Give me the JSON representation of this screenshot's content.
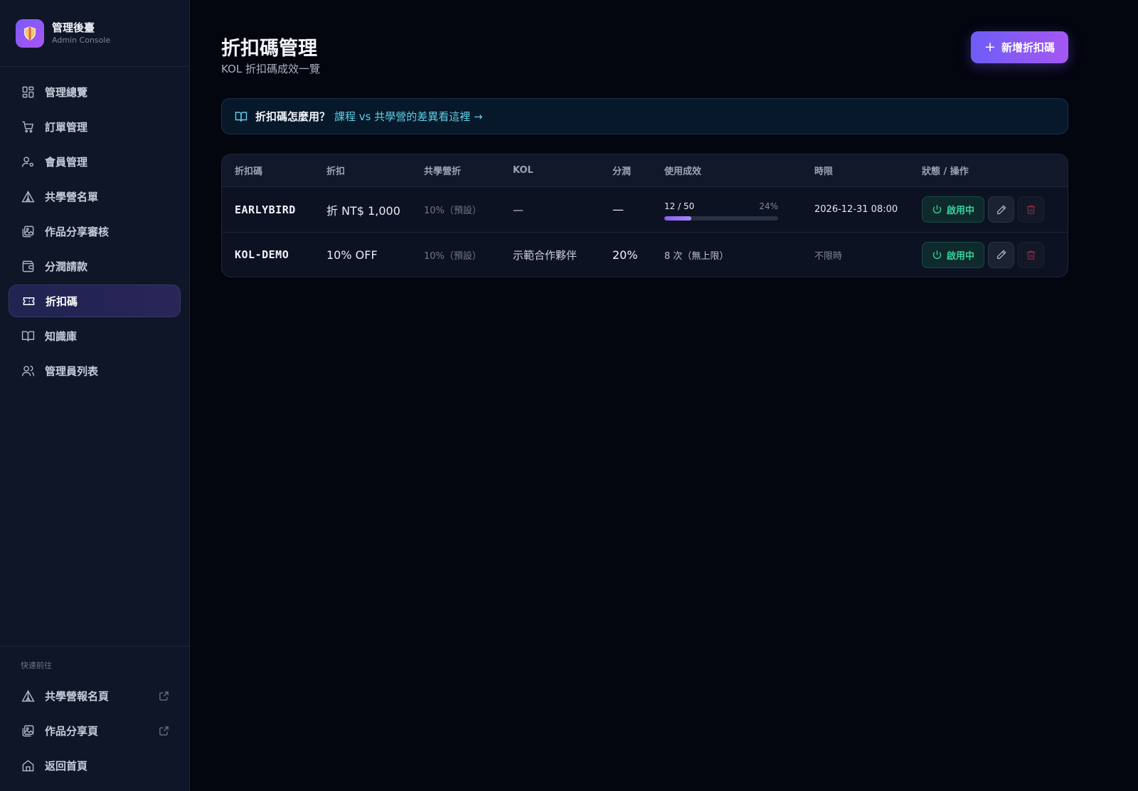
{
  "brand": {
    "title": "管理後臺",
    "subtitle": "Admin Console"
  },
  "nav": {
    "items": [
      {
        "label": "管理總覽",
        "icon": "dashboard-icon"
      },
      {
        "label": "訂單管理",
        "icon": "cart-icon"
      },
      {
        "label": "會員管理",
        "icon": "user-settings-icon"
      },
      {
        "label": "共學營名單",
        "icon": "tent-icon"
      },
      {
        "label": "作品分享審核",
        "icon": "gallery-icon"
      },
      {
        "label": "分潤請款",
        "icon": "wallet-icon"
      },
      {
        "label": "折扣碼",
        "icon": "ticket-icon",
        "active": true
      },
      {
        "label": "知識庫",
        "icon": "book-icon"
      },
      {
        "label": "管理員列表",
        "icon": "users-icon"
      }
    ]
  },
  "quick": {
    "title": "快速前往",
    "items": [
      {
        "label": "共學營報名頁",
        "icon": "tent-icon"
      },
      {
        "label": "作品分享頁",
        "icon": "gallery-icon"
      },
      {
        "label": "返回首頁",
        "icon": "home-icon"
      }
    ]
  },
  "header": {
    "title": "折扣碼管理",
    "subtitle": "KOL 折扣碼成效一覽",
    "add_label": "新增折扣碼"
  },
  "banner": {
    "question": "折扣碼怎麼用？",
    "link": "課程 vs 共學營的差異看這裡 →"
  },
  "table": {
    "headers": [
      "折扣碼",
      "折扣",
      "共學營折",
      "KOL",
      "分潤",
      "使用成效",
      "時限",
      "狀態 / 操作"
    ],
    "rows": [
      {
        "code": "EARLYBIRD",
        "discount": "折 NT$ 1,000",
        "camp_discount": "10%（預設）",
        "kol": "—",
        "share": "—",
        "usage_count": "12 / 50",
        "usage_pct": "24%",
        "usage_fraction": 0.24,
        "deadline": "2026-12-31 08:00",
        "status": "啟用中"
      },
      {
        "code": "KOL-DEMO",
        "discount": "10% OFF",
        "camp_discount": "10%（預設）",
        "kol": "示範合作夥伴",
        "share": "20%",
        "usage_text": "8 次（無上限）",
        "deadline": "不限時",
        "status": "啟用中"
      }
    ]
  },
  "colors": {
    "accent": "#7c5cf6",
    "status_green": "#34d399",
    "link": "#5fd1e8",
    "danger": "#8b2d3f"
  }
}
